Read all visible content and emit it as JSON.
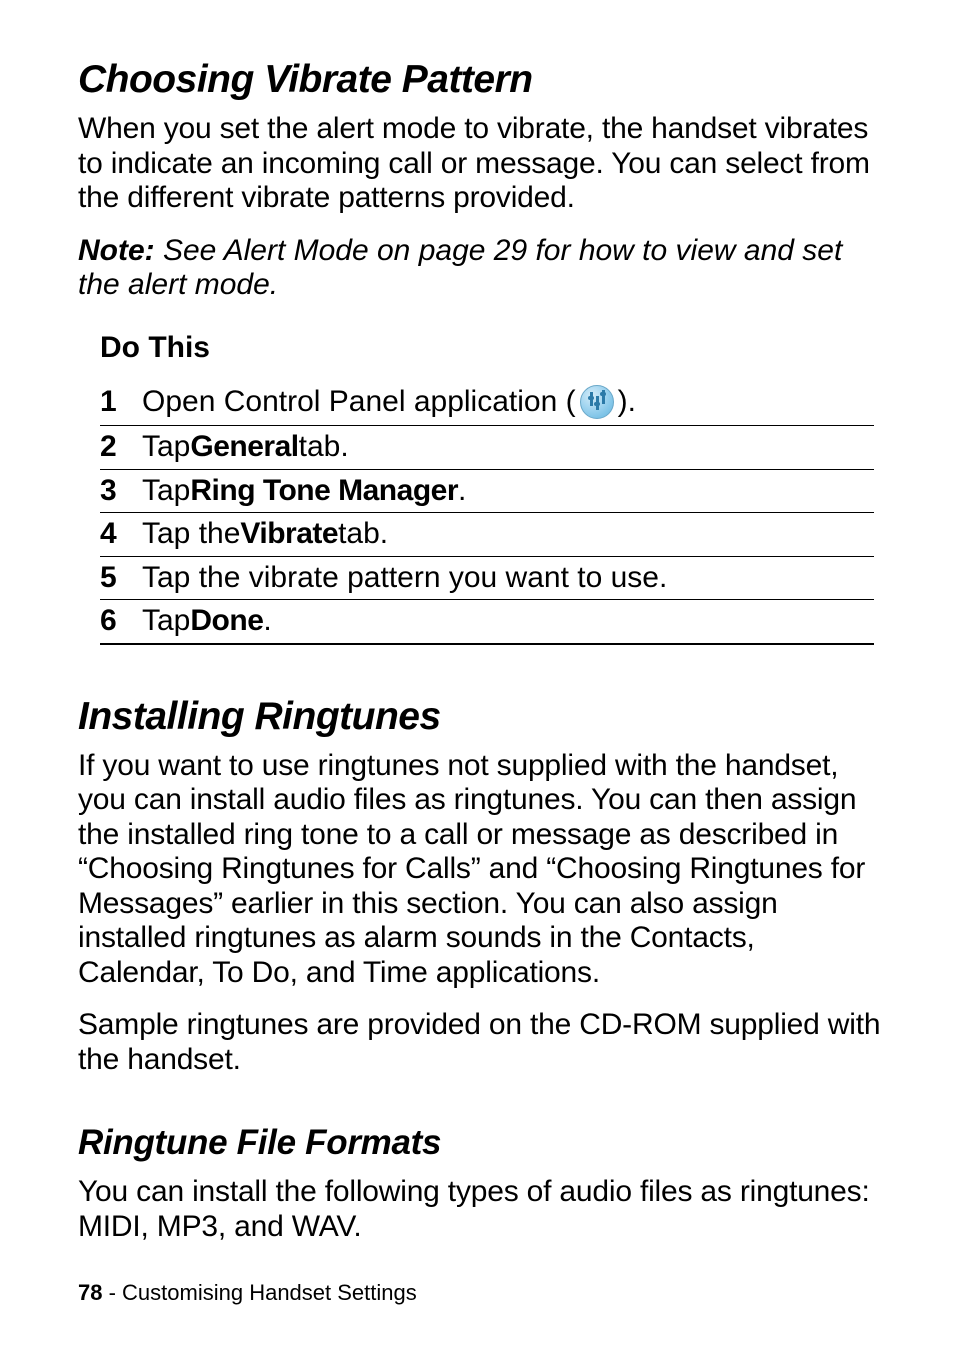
{
  "section1": {
    "heading": "Choosing Vibrate Pattern",
    "intro": "When you set the alert mode to vibrate, the handset vibrates to indicate an incoming call or message. You can select from the different vibrate patterns provided.",
    "note_label": "Note:",
    "note_text": " See Alert Mode on page 29 for how to view and set the alert mode."
  },
  "steps": {
    "header": "Do This",
    "items": [
      {
        "num": "1",
        "pre": "Open Control Panel application (",
        "post": ")."
      },
      {
        "num": "2",
        "pre": "Tap ",
        "bold": "General",
        "post": " tab."
      },
      {
        "num": "3",
        "pre": "Tap ",
        "bold": "Ring Tone Manager",
        "post": "."
      },
      {
        "num": "4",
        "pre": "Tap the ",
        "bold": "Vibrate",
        "post": " tab."
      },
      {
        "num": "5",
        "pre": "Tap the vibrate pattern you want to use."
      },
      {
        "num": "6",
        "pre": "Tap ",
        "bold": "Done",
        "post": "."
      }
    ]
  },
  "section2": {
    "heading": "Installing Ringtunes",
    "para1": "If you want to use ringtunes not supplied with the handset, you can install audio files as ringtunes. You can then assign the installed ring tone to a call or message as described in “Choosing Ringtunes for Calls” and “Choosing Ringtunes for Messages” earlier in this section. You can also assign installed ringtunes as alarm sounds in the Contacts, Calendar, To Do, and Time applications.",
    "para2": "Sample ringtunes are provided on the CD-ROM supplied with the handset."
  },
  "section3": {
    "heading": "Ringtune File Formats",
    "para1": "You can install the following types of audio files as ringtunes: MIDI, MP3, and WAV."
  },
  "footer": {
    "page_num": "78",
    "sep": " - ",
    "title": "Customising Handset Settings"
  }
}
